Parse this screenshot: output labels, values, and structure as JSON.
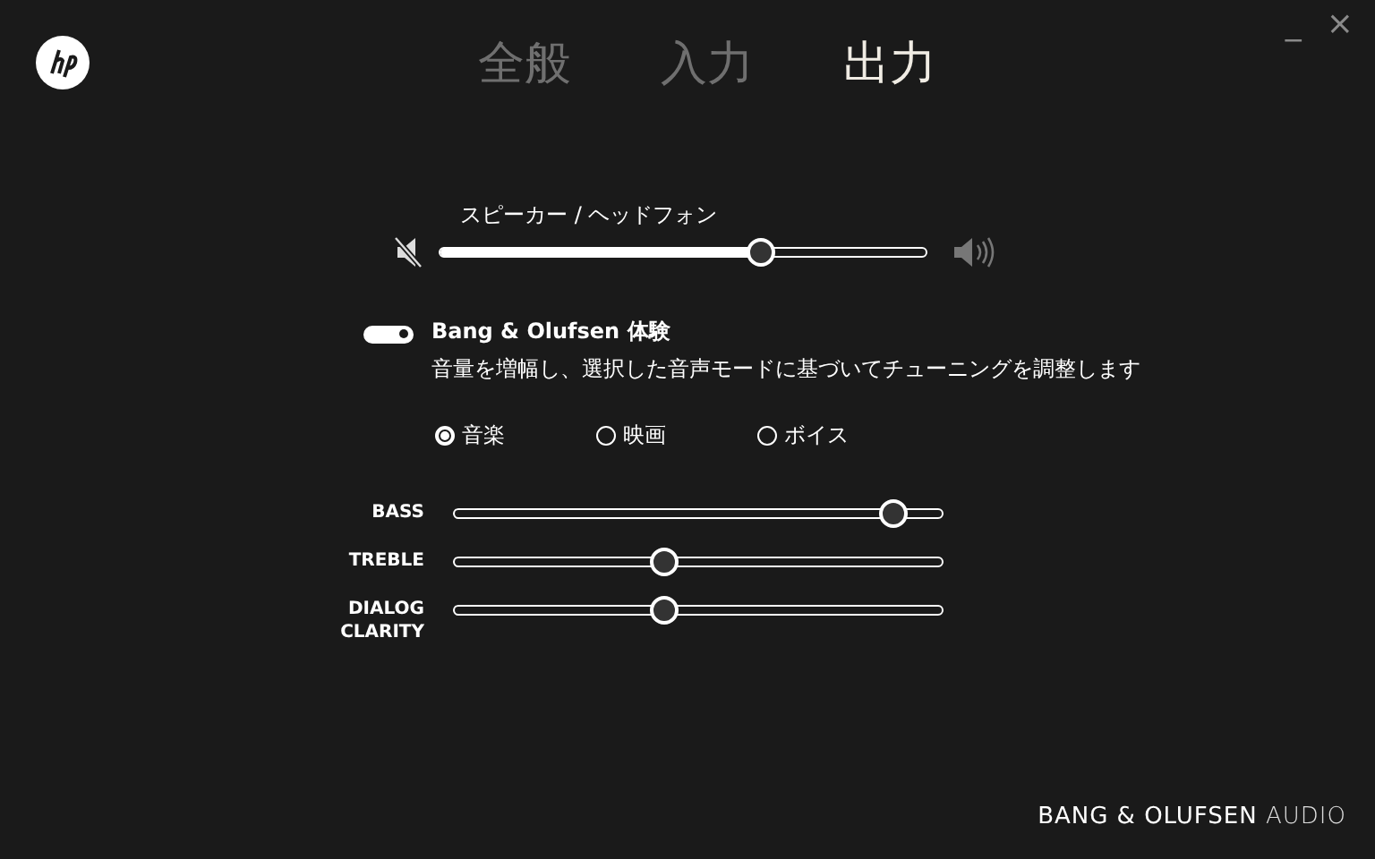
{
  "tabs": [
    {
      "label": "全般",
      "selected": false
    },
    {
      "label": "入力",
      "selected": false
    },
    {
      "label": "出力",
      "selected": true
    }
  ],
  "window_controls": {
    "minimize": "_",
    "close": "×"
  },
  "volume": {
    "label": "スピーカー / ヘッドフォン",
    "level": 0.66
  },
  "enhancement": {
    "title": "Bang & Olufsen 体験",
    "description": "音量を増幅し、選択した音声モードに基づいてチューニングを調整します",
    "on": true
  },
  "modes": [
    {
      "label": "音楽",
      "selected": true
    },
    {
      "label": "映画",
      "selected": false
    },
    {
      "label": "ボイス",
      "selected": false
    }
  ],
  "equalizer": [
    {
      "label": "BASS",
      "level": 0.9
    },
    {
      "label": "TREBLE",
      "level": 0.43
    },
    {
      "label": "DIALOG CLARITY",
      "level": 0.43
    }
  ],
  "footer": {
    "brand": "BANG & OLUFSEN",
    "suffix": "AUDIO"
  }
}
